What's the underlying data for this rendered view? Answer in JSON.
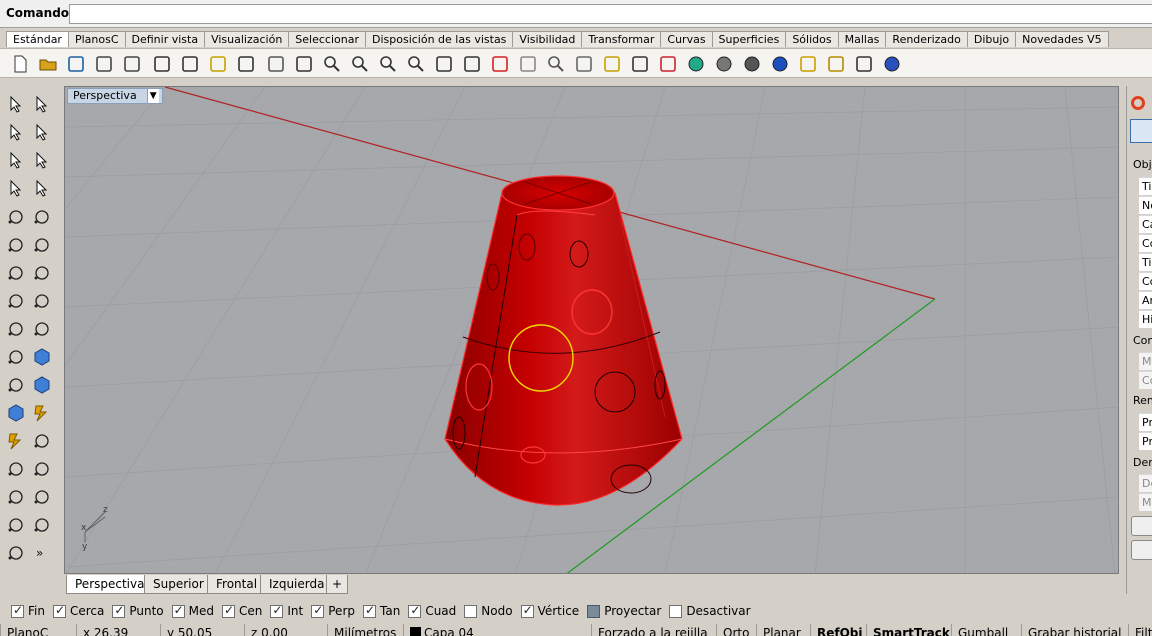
{
  "command": {
    "label": "Comando:",
    "value": ""
  },
  "tabs": [
    "Estándar",
    "PlanosC",
    "Definir vista",
    "Visualización",
    "Seleccionar",
    "Disposición de las vistas",
    "Visibilidad",
    "Transformar",
    "Curvas",
    "Superficies",
    "Sólidos",
    "Mallas",
    "Renderizado",
    "Dibujo",
    "Novedades V5"
  ],
  "active_tab": "Estándar",
  "toolbar_icons": [
    "new-file-icon",
    "open-folder-icon",
    "save-icon",
    "print-icon",
    "import-icon",
    "cut-icon",
    "copy-icon",
    "paste-icon",
    "undo-icon",
    "pan-hand-icon",
    "move-view-icon",
    "zoom-window-icon",
    "zoom-dynamic-icon",
    "zoom-extents-icon",
    "zoom-selected-icon",
    "rotate-view-icon",
    "four-viewports-icon",
    "car-icon",
    "lock-view-icon",
    "circle-select-icon",
    "point-icon",
    "light-bulb-icon",
    "lock-icon",
    "layer-icon",
    "color-wheel-icon",
    "sphere-grey-icon",
    "sphere-render-icon",
    "sphere-blue-icon",
    "highlight-icon",
    "gear-options-icon",
    "snap-grid-icon",
    "help-icon"
  ],
  "viewport": {
    "title": "Perspectiva",
    "axis_labels": {
      "x": "x",
      "y": "y",
      "z": "z"
    }
  },
  "viewport_tabs": [
    "Perspectiva",
    "Superior",
    "Frontal",
    "Izquierda"
  ],
  "add_tab_symbol": "+",
  "right_panel": {
    "sections": [
      "Obje",
      "Con",
      "Ren",
      "Den"
    ],
    "rows": [
      "Ti",
      "Nc",
      "Ca",
      "Cc",
      "Ti",
      "Cc",
      "Ar",
      "Hi",
      "M",
      "Cc",
      "Pr",
      "Pr",
      "De",
      "M"
    ]
  },
  "osnaps": [
    {
      "label": "Fin",
      "checked": true
    },
    {
      "label": "Cerca",
      "checked": true
    },
    {
      "label": "Punto",
      "checked": true
    },
    {
      "label": "Med",
      "checked": true
    },
    {
      "label": "Cen",
      "checked": true
    },
    {
      "label": "Int",
      "checked": true
    },
    {
      "label": "Perp",
      "checked": true
    },
    {
      "label": "Tan",
      "checked": true
    },
    {
      "label": "Cuad",
      "checked": true
    },
    {
      "label": "Nodo",
      "checked": false
    },
    {
      "label": "Vértice",
      "checked": true
    },
    {
      "label": "Proyectar",
      "checked": false,
      "square": true
    },
    {
      "label": "Desactivar",
      "checked": false
    }
  ],
  "status": {
    "plane": "PlanoC",
    "x": "x 26.39",
    "y": "y 50.05",
    "z": "z 0.00",
    "units": "Milímetros",
    "layer": "Capa 04",
    "grid_snap": "Forzado a la rejilla",
    "orto": "Orto",
    "planar": "Planar",
    "refobj": "RefObj",
    "smarttrack": "SmartTrack",
    "gumball": "Gumball",
    "history": "Grabar historial",
    "filter": "Filt"
  },
  "colors": {
    "object_red": "#c80000",
    "viewport_bg": "#a6a8ab",
    "x_axis": "#b22020",
    "y_axis": "#1f9a1f",
    "highlight_circle": "#f2d800"
  }
}
